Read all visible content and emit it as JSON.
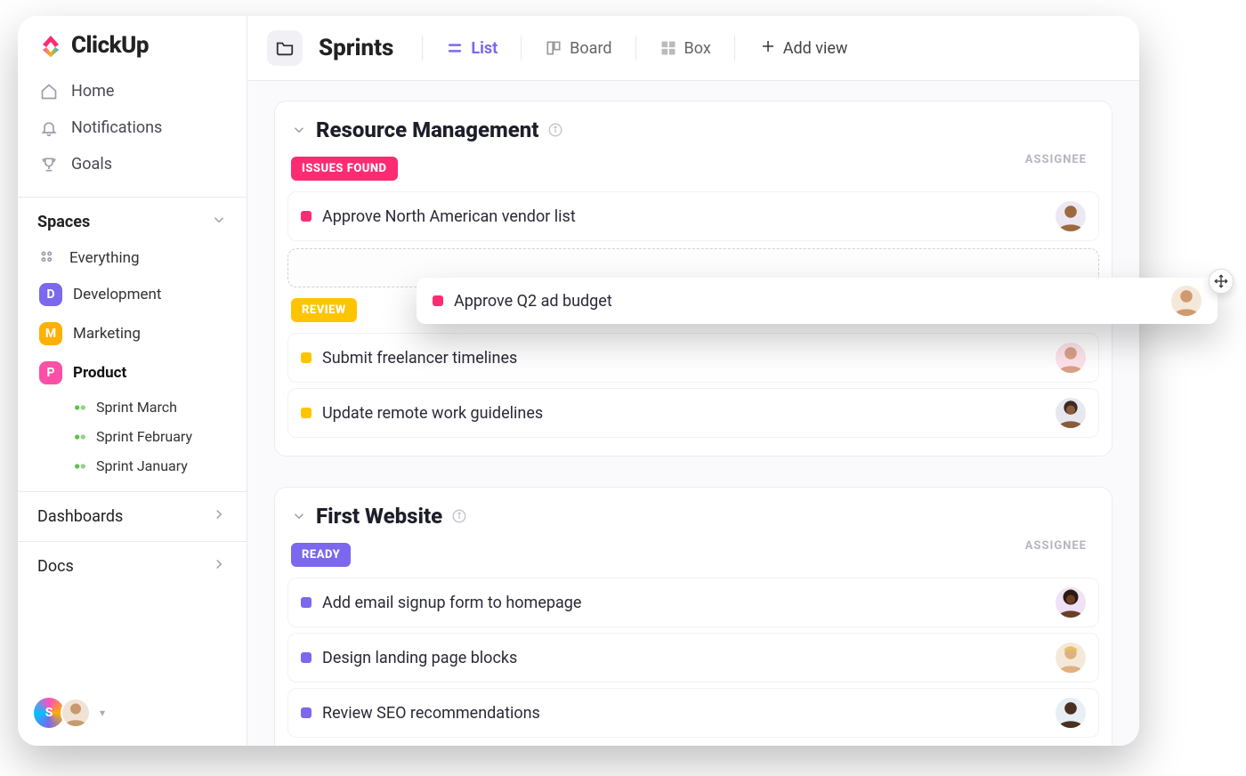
{
  "brand": {
    "name": "ClickUp"
  },
  "sidebar": {
    "nav": {
      "home": "Home",
      "notifications": "Notifications",
      "goals": "Goals"
    },
    "spaces_header": "Spaces",
    "everything": "Everything",
    "spaces": [
      {
        "letter": "D",
        "label": "Development"
      },
      {
        "letter": "M",
        "label": "Marketing"
      },
      {
        "letter": "P",
        "label": "Product"
      }
    ],
    "sprints": [
      "Sprint  March",
      "Sprint  February",
      "Sprint January"
    ],
    "dashboards": "Dashboards",
    "docs": "Docs",
    "workspace_letter": "S"
  },
  "header": {
    "title": "Sprints",
    "views": {
      "list": "List",
      "board": "Board",
      "box": "Box",
      "add": "Add view"
    }
  },
  "labels": {
    "assignee": "ASSIGNEE"
  },
  "groups": [
    {
      "title": "Resource Management",
      "sections": [
        {
          "status_label": "ISSUES FOUND",
          "status_key": "issues",
          "tasks": [
            {
              "title": "Approve North American vendor list",
              "dot": "pink",
              "avatar_bg": "#f7e6c9"
            }
          ],
          "has_drop_placeholder": true
        },
        {
          "status_label": "REVIEW",
          "status_key": "review",
          "tasks": [
            {
              "title": "Submit freelancer timelines",
              "dot": "yellow",
              "avatar_bg": "#fde2ea"
            },
            {
              "title": "Update remote work guidelines",
              "dot": "yellow",
              "avatar_bg": "#e7e7ef"
            }
          ]
        }
      ]
    },
    {
      "title": "First Website",
      "sections": [
        {
          "status_label": "READY",
          "status_key": "ready",
          "tasks": [
            {
              "title": "Add email signup form to homepage",
              "dot": "purple",
              "avatar_bg": "#efe1f7"
            },
            {
              "title": "Design landing page blocks",
              "dot": "purple",
              "avatar_bg": "#f4e9d8"
            },
            {
              "title": "Review SEO recommendations",
              "dot": "purple",
              "avatar_bg": "#e7eef4"
            }
          ]
        }
      ]
    }
  ],
  "dragging": {
    "title": "Approve Q2 ad budget",
    "dot": "pink",
    "avatar_bg": "#f4e9d8"
  }
}
